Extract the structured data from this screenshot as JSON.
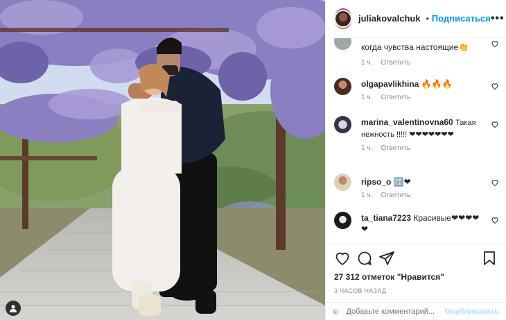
{
  "post": {
    "username": "juliakovalchuk",
    "separator": "•",
    "follow_label": "Подписаться",
    "more_label": "•••",
    "photo_alt": "Couple posing under wisteria arbor"
  },
  "comments": [
    {
      "username": "",
      "text": "когда чувства настоящие👏",
      "time": "1 ч.",
      "reply": "Ответить"
    },
    {
      "username": "olgapavlikhina",
      "text": "🔥🔥🔥",
      "time": "1 ч.",
      "reply": "Ответить"
    },
    {
      "username": "marina_valentinovna60",
      "text": "Такая нежность !!!!! ❤❤❤❤❤❤❤",
      "time": "1 ч.",
      "reply": "Ответить"
    },
    {
      "username": "ripso_o",
      "text": "🔠❤",
      "time": "1 ч.",
      "reply": "Ответить"
    },
    {
      "username": "ta_tiana7223",
      "text": "Красивые❤❤❤❤❤",
      "time": "",
      "reply": ""
    }
  ],
  "footer": {
    "likes": "27 312 отметок \"Нравится\"",
    "time_ago": "3 ЧАСОВ НАЗАД",
    "comment_placeholder": "Добавьте комментарий...",
    "publish_label": "Опубликовать"
  },
  "colors": {
    "accent": "#0095f6",
    "accent_disabled": "#b2dffc",
    "heart": "#ed1c24",
    "muted": "#8e8e8e"
  },
  "icons": [
    "heart-icon",
    "comment-icon",
    "share-icon",
    "bookmark-icon",
    "emoji-icon",
    "user-tag-icon",
    "verified-icon",
    "more-icon"
  ]
}
